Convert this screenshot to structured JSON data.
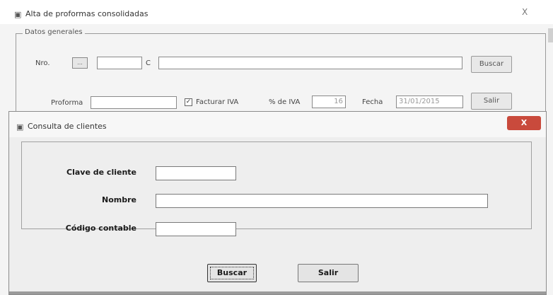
{
  "background_window": {
    "title": "Alta de proformas consolidadas",
    "close_glyph": "X",
    "group_title": "Datos generales",
    "cliente_label": "Nro.",
    "small_button_label": "...",
    "c_label": "C",
    "buscar_button": "Buscar",
    "proforma_label": "Proforma",
    "facturar_iva_label": "Facturar IVA",
    "facturar_iva_checked": true,
    "iva_pct_label": "% de IVA",
    "iva_pct_value": "16",
    "fecha_label": "Fecha",
    "fecha_value": "31/01/2015",
    "salir_button": "Salir"
  },
  "dialog": {
    "title": "Consulta de clientes",
    "close_glyph": "X",
    "fields": {
      "clave_label": "Clave de cliente",
      "clave_value": "",
      "nombre_label": "Nombre",
      "nombre_value": "",
      "codigo_label": "Código contable",
      "codigo_value": ""
    },
    "buttons": {
      "buscar": "Buscar",
      "salir": "Salir"
    }
  },
  "colors": {
    "dialog_close_bg": "#c94a3c",
    "window_bg": "#f4f4f4"
  }
}
